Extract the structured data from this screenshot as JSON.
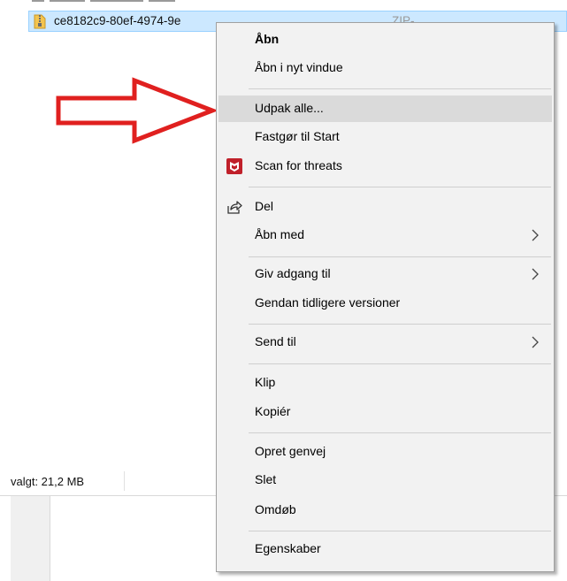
{
  "file": {
    "name": "ce8182c9-80ef-4974-9e",
    "meta": "ZIP-"
  },
  "status": {
    "selected": "valgt: 21,2 MB"
  },
  "context_menu": {
    "items": [
      {
        "label": "Åbn"
      },
      {
        "label": "Åbn i nyt vindue"
      },
      {
        "label": "Udpak alle..."
      },
      {
        "label": "Fastgør til Start"
      },
      {
        "label": "Scan for threats",
        "icon": "mcafee-icon"
      },
      {
        "label": "Del",
        "icon": "share-icon"
      },
      {
        "label": "Åbn med",
        "submenu": true
      },
      {
        "label": "Giv adgang til",
        "submenu": true
      },
      {
        "label": "Gendan tidligere versioner"
      },
      {
        "label": "Send til",
        "submenu": true
      },
      {
        "label": "Klip"
      },
      {
        "label": "Kopiér"
      },
      {
        "label": "Opret genvej"
      },
      {
        "label": "Slet"
      },
      {
        "label": "Omdøb"
      },
      {
        "label": "Egenskaber"
      }
    ]
  },
  "colors": {
    "selection": "#cce8ff",
    "menu_background": "#f2f2f2",
    "menu_highlight": "#dadada",
    "arrow": "#e0201f",
    "mcafee": "#c0202a"
  }
}
